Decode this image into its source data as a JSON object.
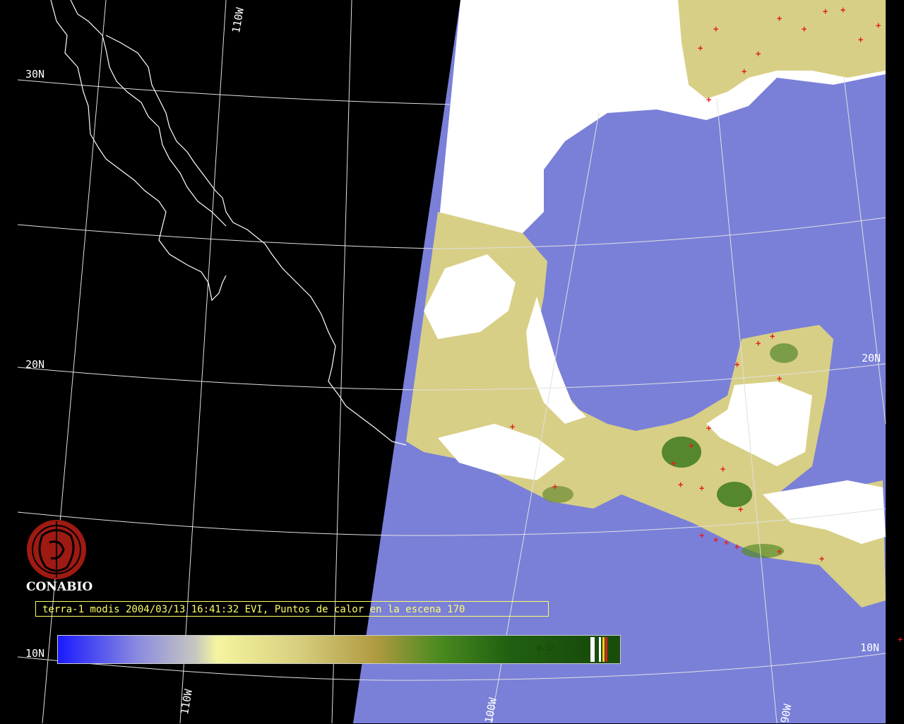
{
  "map": {
    "caption": "terra-1 modis 2004/03/13 16:41:32 EVI, Puntos de calor en la escena 170",
    "logo_text": "CONABIO",
    "grid_labels": {
      "lat_30": "30N",
      "lat_20_left": "20N",
      "lat_20_right": "20N",
      "lat_10_left": "10N",
      "lat_10_right": "10N",
      "lon_110_top": "110W",
      "lon_110_bottom": "110W",
      "lon_100_bottom": "100W",
      "lon_90_bottom": "90W"
    },
    "colorbar": {
      "value_label": "0.12",
      "colors": [
        "#1a1aff",
        "#8a8ae0",
        "#c7c7c0",
        "#f5f5a0",
        "#d8d080",
        "#b09a40",
        "#4a8a20",
        "#206010",
        "#184d0c"
      ]
    },
    "layers": {
      "ocean_color": "#7a80d8",
      "cloud_color": "#ffffff",
      "vegetation_color": "#d8cf86",
      "dense_vegetation_color": "#3d7a1f",
      "hotspot_color": "#e02020",
      "coastline_color": "#ffffff",
      "graticule_color": "#ffffff"
    }
  }
}
